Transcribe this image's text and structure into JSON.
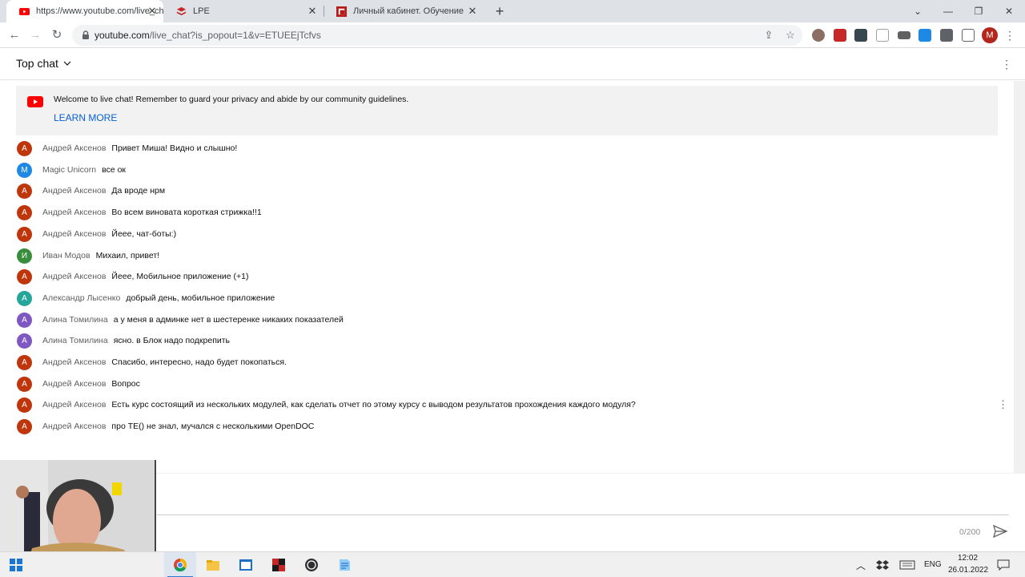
{
  "browser": {
    "tabs": [
      {
        "title": "https://www.youtube.com/live_ch",
        "icon": "youtube-icon",
        "close": "✕"
      },
      {
        "title": "LPE",
        "icon": "lpe-icon",
        "close": "✕"
      },
      {
        "title": "Личный кабинет. Обучение",
        "icon": "cabinet-icon",
        "close": "✕"
      }
    ],
    "new_tab": "+",
    "url_host": "youtube.com",
    "url_path": "/live_chat?is_popout=1&v=ETUEEjTcfvs",
    "profile_initial": "M"
  },
  "chat": {
    "mode_label": "Top chat",
    "welcome_text": "Welcome to live chat! Remember to guard your privacy and abide by our community guidelines.",
    "learn_more": "LEARN MORE",
    "messages": [
      {
        "initial": "А",
        "author": "Андрей Аксенов",
        "text": "Привет Миша! Видно и слышно!",
        "color": "#bf360c"
      },
      {
        "initial": "M",
        "author": "Magic Unicorn",
        "text": "все ок",
        "color": "#1e88e5"
      },
      {
        "initial": "А",
        "author": "Андрей Аксенов",
        "text": "Да вроде нрм",
        "color": "#bf360c"
      },
      {
        "initial": "А",
        "author": "Андрей Аксенов",
        "text": "Во всем виновата короткая стрижка!!1",
        "color": "#bf360c"
      },
      {
        "initial": "А",
        "author": "Андрей Аксенов",
        "text": "Йеее, чат-боты:)",
        "color": "#bf360c"
      },
      {
        "initial": "И",
        "author": "Иван Модов",
        "text": "Михаил, привет!",
        "color": "#388e3c"
      },
      {
        "initial": "А",
        "author": "Андрей Аксенов",
        "text": "Йеее, Мобильное приложение (+1)",
        "color": "#bf360c"
      },
      {
        "initial": "А",
        "author": "Александр Лысенко",
        "text": "добрый день, мобильное приложение",
        "color": "#26a69a"
      },
      {
        "initial": "А",
        "author": "Алина Томилина",
        "text": "а у меня в админке нет в шестеренке никаких показателей",
        "color": "#7e57c2"
      },
      {
        "initial": "А",
        "author": "Алина Томилина",
        "text": "ясно. в Блок надо подкрепить",
        "color": "#7e57c2"
      },
      {
        "initial": "А",
        "author": "Андрей Аксенов",
        "text": "Спасибо, интересно, надо будет покопаться.",
        "color": "#bf360c"
      },
      {
        "initial": "А",
        "author": "Андрей Аксенов",
        "text": "Вопрос",
        "color": "#bf360c"
      },
      {
        "initial": "А",
        "author": "Андрей Аксенов",
        "text": "Есть курс состоящий из нескольких модулей, как сделать отчет по этому курсу с выводом результатов прохождения каждого модуля?",
        "color": "#bf360c"
      },
      {
        "initial": "А",
        "author": "Андрей Аксенов",
        "text": "про TE() не знал, мучался с несколькими OpenDOC",
        "color": "#bf360c"
      }
    ],
    "char_counter": "0/200"
  },
  "taskbar": {
    "language": "ENG",
    "time": "12:02",
    "date": "26.01.2022"
  },
  "colors": {
    "youtube_red": "#ff0000",
    "link_blue": "#065fd4"
  }
}
